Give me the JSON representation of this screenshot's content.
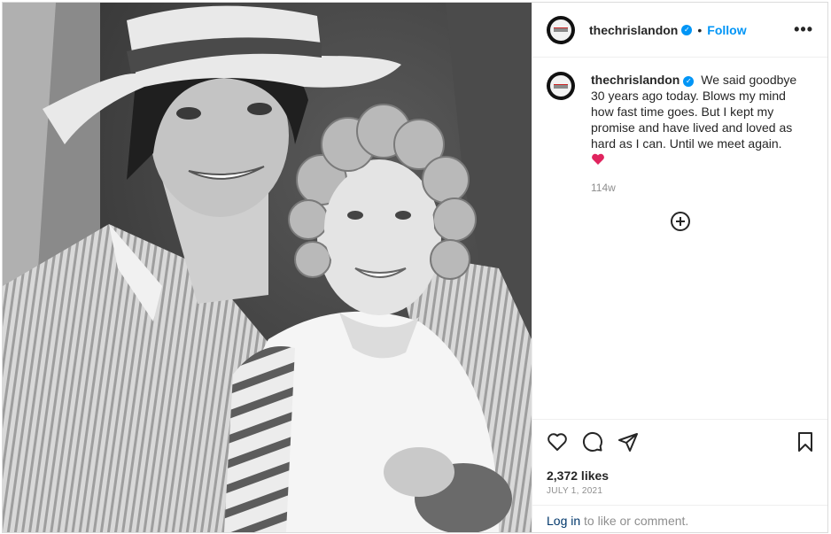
{
  "post": {
    "username": "thechrislandon",
    "verified_icon": "verified-badge-icon",
    "separator": "•",
    "follow_label": "Follow",
    "more_icon": "more-options-icon",
    "more_label": "•••"
  },
  "caption": {
    "username": "thechrislandon",
    "text": "We said goodbye 30 years ago today. Blows my mind how fast time goes. But I kept my promise and have lived and loved as hard as I can. Until we meet again.",
    "emoji": "heart-emoji",
    "time_ago": "114w"
  },
  "actions": {
    "icons": [
      "heart-icon",
      "comment-icon",
      "share-icon",
      "bookmark-icon"
    ],
    "likes": "2,372 likes",
    "date": "JULY 1, 2021"
  },
  "footer": {
    "login_link": "Log in",
    "login_suffix": " to like or comment."
  },
  "colors": {
    "accent": "#0095f6",
    "text": "#262626",
    "secondary": "#8e8e8e",
    "link": "#00376b",
    "heart": "#e0245e"
  },
  "photo": {
    "icon": "photo-post-image"
  }
}
